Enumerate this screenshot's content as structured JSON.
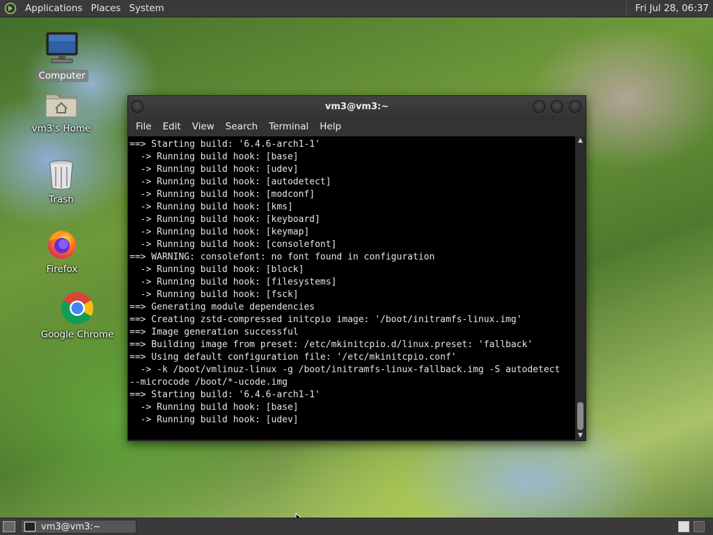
{
  "top_panel": {
    "menus": [
      "Applications",
      "Places",
      "System"
    ],
    "clock": "Fri Jul 28, 06:37"
  },
  "desktop_icons": [
    {
      "label": "Computer",
      "icon": "computer-icon"
    },
    {
      "label": "vm3's Home",
      "icon": "home-folder-icon"
    },
    {
      "label": "Trash",
      "icon": "trash-icon"
    },
    {
      "label": "Firefox",
      "icon": "firefox-icon"
    },
    {
      "label": "Google Chrome",
      "icon": "chrome-icon"
    }
  ],
  "terminal": {
    "title": "vm3@vm3:~",
    "menu": [
      "File",
      "Edit",
      "View",
      "Search",
      "Terminal",
      "Help"
    ],
    "lines": [
      "==> Starting build: '6.4.6-arch1-1'",
      "  -> Running build hook: [base]",
      "  -> Running build hook: [udev]",
      "  -> Running build hook: [autodetect]",
      "  -> Running build hook: [modconf]",
      "  -> Running build hook: [kms]",
      "  -> Running build hook: [keyboard]",
      "  -> Running build hook: [keymap]",
      "  -> Running build hook: [consolefont]",
      "==> WARNING: consolefont: no font found in configuration",
      "  -> Running build hook: [block]",
      "  -> Running build hook: [filesystems]",
      "  -> Running build hook: [fsck]",
      "==> Generating module dependencies",
      "==> Creating zstd-compressed initcpio image: '/boot/initramfs-linux.img'",
      "==> Image generation successful",
      "==> Building image from preset: /etc/mkinitcpio.d/linux.preset: 'fallback'",
      "==> Using default configuration file: '/etc/mkinitcpio.conf'",
      "  -> -k /boot/vmlinuz-linux -g /boot/initramfs-linux-fallback.img -S autodetect",
      "--microcode /boot/*-ucode.img",
      "==> Starting build: '6.4.6-arch1-1'",
      "  -> Running build hook: [base]",
      "  -> Running build hook: [udev]"
    ]
  },
  "taskbar": {
    "task_title": "vm3@vm3:~"
  }
}
